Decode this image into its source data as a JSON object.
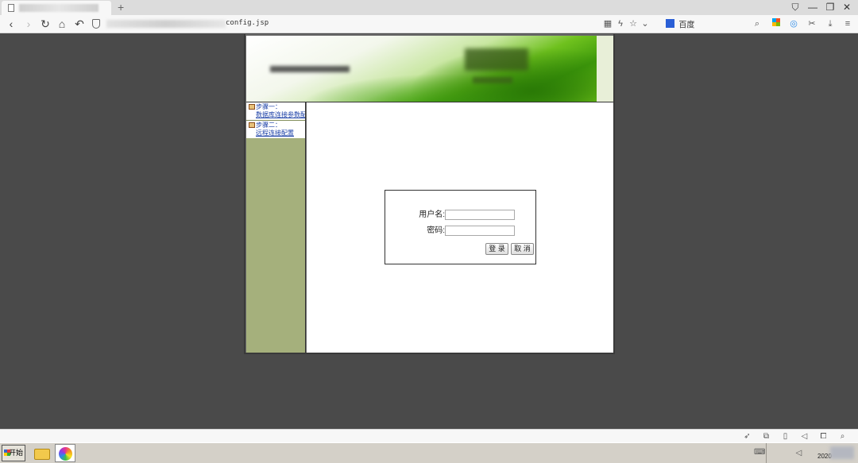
{
  "browser": {
    "new_tab_glyph": "+",
    "url_suffix": "config.jsp",
    "search_engine_label": "百度",
    "icons": {
      "back": "chevron-left-icon",
      "forward": "chevron-right-icon",
      "reload": "reload-icon",
      "home": "home-icon",
      "undo": "undo-icon",
      "security": "shield-icon",
      "qr": "qr-code-icon",
      "bolt": "lightning-icon",
      "star": "star-icon",
      "dropdown": "chevron-down-icon",
      "search": "search-icon",
      "apps": "apps-grid-icon",
      "scissors": "scissors-icon",
      "download": "download-icon",
      "menu": "hamburger-menu-icon"
    }
  },
  "page": {
    "sidebar": {
      "steps": [
        {
          "title": "步骤一：",
          "link": "数据库连接参数配"
        },
        {
          "title": "步骤二：",
          "link": "远程连接配置"
        }
      ]
    },
    "login": {
      "username_label": "用户名:",
      "username_value": "",
      "password_label": "密码:",
      "password_value": "",
      "submit_label": "登 录",
      "cancel_label": "取 消"
    }
  },
  "taskbar": {
    "start_label": "开始",
    "clock_text": "2020"
  }
}
